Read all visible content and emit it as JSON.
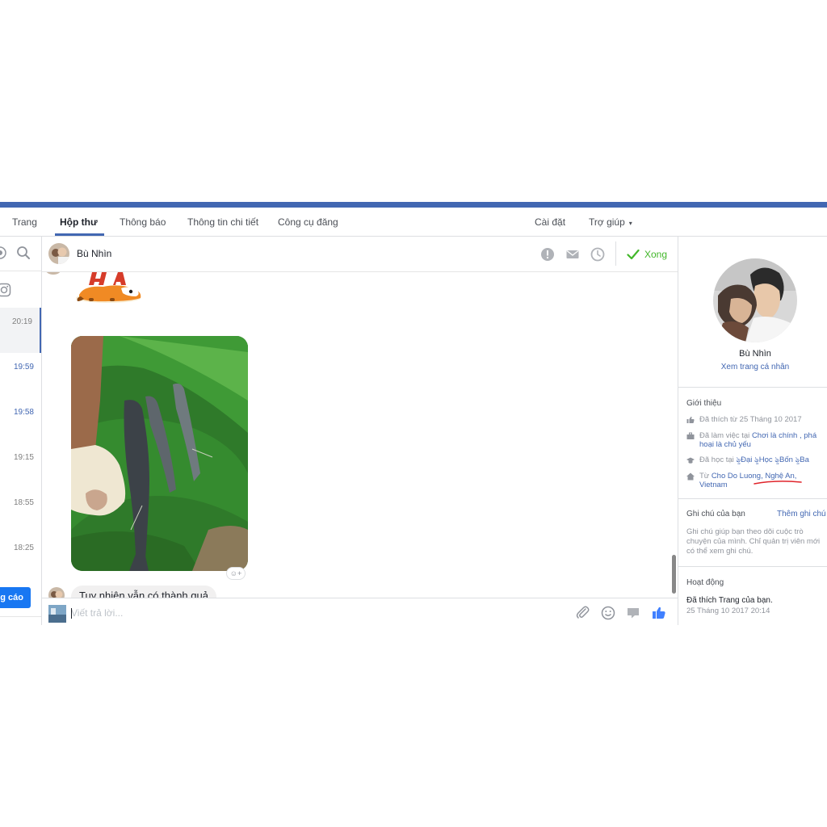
{
  "nav": {
    "tabs": [
      {
        "label": "Trang"
      },
      {
        "label": "Hộp thư"
      },
      {
        "label": "Thông báo"
      },
      {
        "label": "Thông tin chi tiết"
      },
      {
        "label": "Công cụ đăng"
      }
    ],
    "settings_label": "Cài đặt",
    "help_label": "Trợ giúp",
    "help_caret": "▾"
  },
  "inbox_list": {
    "times": [
      "20:19",
      "19:59",
      "19:58",
      "19:15",
      "18:55",
      "18:25"
    ],
    "promote_label": "ng cáo"
  },
  "conversation": {
    "contact_name": "Bù Nhìn",
    "done_label": "Xong",
    "last_message": "Tuy nhiên vẫn có thành quả",
    "composer_placeholder": "Viết trả lời..."
  },
  "profile": {
    "name": "Bù Nhìn",
    "view_profile": "Xem trang cá nhân",
    "intro_heading": "Giới thiệu",
    "liked_since": "Đã thích từ 25 Tháng 10 2017",
    "work_prefix": "Đã làm việc tại ",
    "work_place": "Chơi là chính , phá hoại là chủ yếu",
    "study_prefix": "Đã học tại ",
    "study_place": "ৡĐại ৡHọc ৡBốn ৡBa",
    "from_prefix": "Từ ",
    "from_place": "Cho Do Luong, Nghệ An, Vietnam"
  },
  "notes": {
    "heading": "Ghi chú của bạn",
    "add_label": "Thêm ghi chú",
    "help_text": "Ghi chú giúp bạn theo dõi cuộc trò chuyện của mình. Chỉ quản trị viên mới có thể xem ghi chú."
  },
  "activity": {
    "heading": "Hoạt động",
    "text": "Đã thích Trang của bạn.",
    "time": "25 Tháng 10 2017 20:14"
  },
  "colors": {
    "brand": "#4267b2",
    "done_green": "#42b72a",
    "promote_blue": "#1877f2",
    "like_blue": "#4080ff",
    "annotation_red": "#e0242b"
  },
  "icons": {
    "left": [
      "messenger-icon",
      "search-icon",
      "instagram-icon"
    ],
    "header": [
      "alert-icon",
      "mail-icon",
      "clock-icon",
      "check-icon"
    ],
    "composer": [
      "paperclip-icon",
      "emoji-icon",
      "sticker-icon",
      "thumbs-up-icon"
    ],
    "intro": [
      "like-icon",
      "briefcase-icon",
      "graduation-cap-icon",
      "home-icon"
    ]
  }
}
